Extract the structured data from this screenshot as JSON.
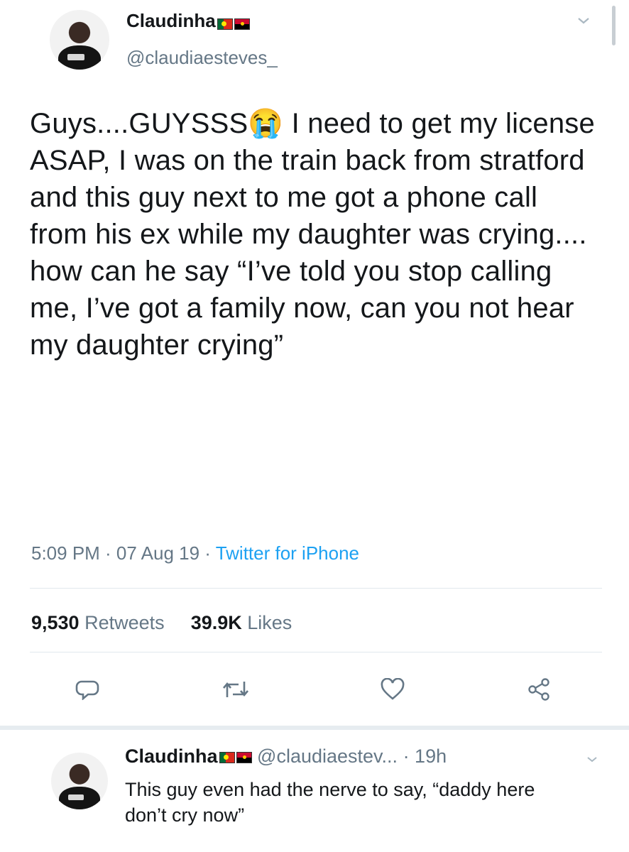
{
  "tweet": {
    "display_name": "Claudinha",
    "handle": "@claudiaesteves_",
    "text": "Guys....GUYSSS😭 I need to get my license ASAP, I was on the train back from stratford and this guy next to me got a phone call from his ex while my daughter was crying.... how can he say “I’ve told you stop calling me, I’ve got a family now, can you not hear my daughter crying”",
    "timestamp": "5:09 PM · 07 Aug 19 · ",
    "source": "Twitter for iPhone",
    "retweet_count": "9,530",
    "retweet_label": "Retweets",
    "like_count": "39.9K",
    "like_label": "Likes",
    "flags": [
      "portugal-flag",
      "angola-flag"
    ]
  },
  "actions": [
    "reply-icon",
    "retweet-icon",
    "like-icon",
    "share-icon"
  ],
  "reply": {
    "display_name": "Claudinha",
    "handle": "@claudiaestev...",
    "time": "· 19h",
    "text": "This guy even had the nerve to say, “daddy here don’t cry now”"
  },
  "colors": {
    "link": "#1da1f2",
    "muted": "#657786",
    "text": "#14171a"
  }
}
